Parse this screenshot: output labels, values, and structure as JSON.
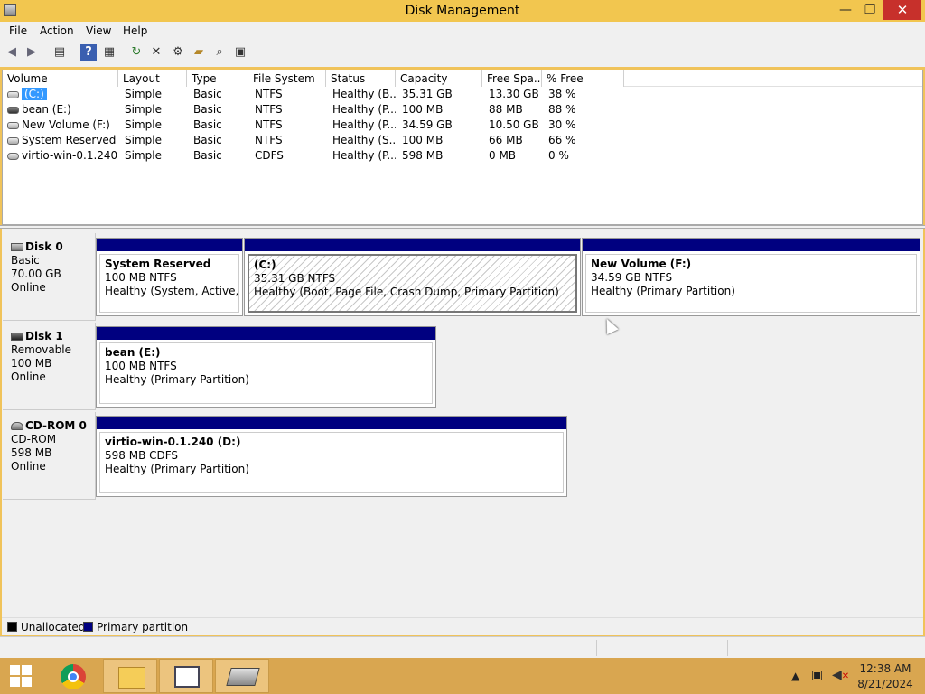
{
  "window": {
    "title": "Disk Management",
    "minimize": "—",
    "maximize": "❐",
    "close": "✕"
  },
  "menu": [
    "File",
    "Action",
    "View",
    "Help"
  ],
  "toolbar": {
    "icons": [
      "back-icon",
      "forward-icon",
      "show-hide-console-tree-icon",
      "help-icon",
      "properties-icon",
      "refresh-icon",
      "delete-icon",
      "settings-icon",
      "open-folder-icon",
      "search-icon",
      "disk-icon"
    ]
  },
  "table": {
    "columns": [
      "Volume",
      "Layout",
      "Type",
      "File System",
      "Status",
      "Capacity",
      "Free Spa...",
      "% Free"
    ],
    "rows": [
      {
        "volume": "(C:)",
        "layout": "Simple",
        "type": "Basic",
        "fs": "NTFS",
        "status": "Healthy (B...",
        "capacity": "35.31 GB",
        "free": "13.30 GB",
        "pct": "38 %"
      },
      {
        "volume": "bean (E:)",
        "layout": "Simple",
        "type": "Basic",
        "fs": "NTFS",
        "status": "Healthy (P...",
        "capacity": "100 MB",
        "free": "88 MB",
        "pct": "88 %"
      },
      {
        "volume": "New Volume (F:)",
        "layout": "Simple",
        "type": "Basic",
        "fs": "NTFS",
        "status": "Healthy (P...",
        "capacity": "34.59 GB",
        "free": "10.50 GB",
        "pct": "30 %"
      },
      {
        "volume": "System Reserved",
        "layout": "Simple",
        "type": "Basic",
        "fs": "NTFS",
        "status": "Healthy (S...",
        "capacity": "100 MB",
        "free": "66 MB",
        "pct": "66 %"
      },
      {
        "volume": "virtio-win-0.1.240 ...",
        "layout": "Simple",
        "type": "Basic",
        "fs": "CDFS",
        "status": "Healthy (P...",
        "capacity": "598 MB",
        "free": "0 MB",
        "pct": "0 %"
      }
    ]
  },
  "disks": [
    {
      "name": "Disk 0",
      "type": "Basic",
      "size": "70.00 GB",
      "state": "Online",
      "partitions": [
        {
          "name": "System Reserved",
          "size": "100 MB NTFS",
          "status": "Healthy (System, Active, Primary Partition)"
        },
        {
          "name": "(C:)",
          "size": "35.31 GB NTFS",
          "status": "Healthy (Boot, Page File, Crash Dump, Primary Partition)"
        },
        {
          "name": "New Volume  (F:)",
          "size": "34.59 GB NTFS",
          "status": "Healthy (Primary Partition)"
        }
      ]
    },
    {
      "name": "Disk 1",
      "type": "Removable",
      "size": "100 MB",
      "state": "Online",
      "partitions": [
        {
          "name": "bean  (E:)",
          "size": "100 MB NTFS",
          "status": "Healthy (Primary Partition)"
        }
      ]
    },
    {
      "name": "CD-ROM 0",
      "type": "CD-ROM",
      "size": "598 MB",
      "state": "Online",
      "partitions": [
        {
          "name": "virtio-win-0.1.240  (D:)",
          "size": "598 MB CDFS",
          "status": "Healthy (Primary Partition)"
        }
      ]
    }
  ],
  "legend": [
    {
      "label": "Unallocated",
      "color": "#000000"
    },
    {
      "label": "Primary partition",
      "color": "#000080"
    }
  ],
  "taskbar": {
    "apps": [
      "chrome-icon",
      "file-explorer-icon",
      "mmc-icon",
      "disk-management-icon"
    ],
    "tray_icons": [
      "show-hidden-icons-icon",
      "network-icon",
      "volume-muted-icon"
    ],
    "time": "12:38 AM",
    "date": "8/21/2024"
  }
}
